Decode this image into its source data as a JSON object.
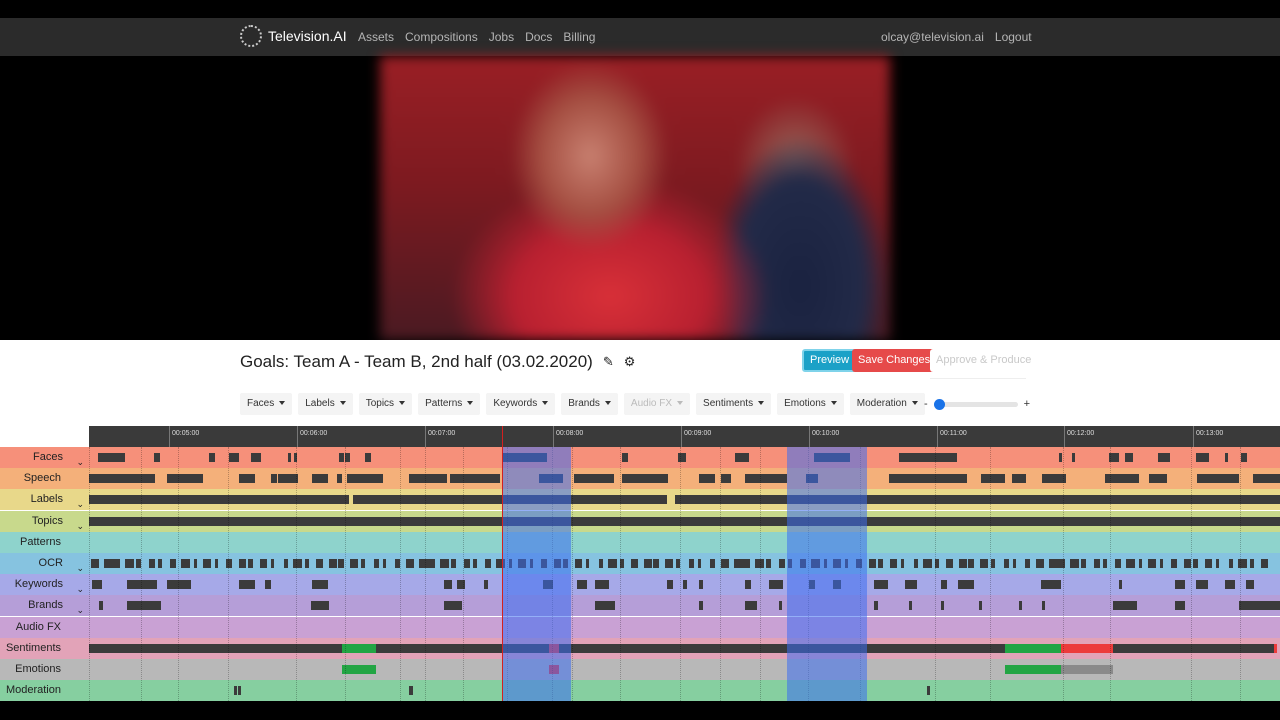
{
  "nav": {
    "brand": "Television.AI",
    "links": [
      "Assets",
      "Compositions",
      "Jobs",
      "Docs",
      "Billing"
    ],
    "user_email": "olcay@television.ai",
    "logout": "Logout"
  },
  "editor": {
    "title": "Goals: Team A - Team B, 2nd half (03.02.2020)",
    "edit_icon": "pencil-icon",
    "settings_icon": "gear-icon",
    "preview": "Preview",
    "save": "Save Changes",
    "approve": "Approve & Produce"
  },
  "filters": [
    {
      "label": "Faces",
      "disabled": false
    },
    {
      "label": "Labels",
      "disabled": false
    },
    {
      "label": "Topics",
      "disabled": false
    },
    {
      "label": "Patterns",
      "disabled": false
    },
    {
      "label": "Keywords",
      "disabled": false
    },
    {
      "label": "Brands",
      "disabled": false
    },
    {
      "label": "Audio FX",
      "disabled": true
    },
    {
      "label": "Sentiments",
      "disabled": false
    },
    {
      "label": "Emotions",
      "disabled": false
    },
    {
      "label": "Moderation",
      "disabled": false
    }
  ],
  "zoom": {
    "minus": "-",
    "plus": "+",
    "level": 0
  },
  "timeline": {
    "ticks": [
      "00:05:00",
      "00:06:00",
      "00:07:00",
      "00:08:00",
      "00:09:00",
      "00:10:00",
      "00:11:00",
      "00:12:00",
      "00:13:00"
    ],
    "rows": [
      {
        "label": "Faces",
        "chevron": true,
        "color": "#f6907a"
      },
      {
        "label": "Speech",
        "chevron": false,
        "color": "#f4b07a"
      },
      {
        "label": "Labels",
        "chevron": true,
        "color": "#e8d88a"
      },
      {
        "label": "Topics",
        "chevron": true,
        "color": "#c8d98c"
      },
      {
        "label": "Patterns",
        "chevron": false,
        "color": "#8ed3cc"
      },
      {
        "label": "OCR",
        "chevron": true,
        "color": "#86c3e0"
      },
      {
        "label": "Keywords",
        "chevron": true,
        "color": "#a6a9e8"
      },
      {
        "label": "Brands",
        "chevron": true,
        "color": "#b59ed8"
      },
      {
        "label": "Audio FX",
        "chevron": false,
        "color": "#c9a1d4"
      },
      {
        "label": "Sentiments",
        "chevron": false,
        "color": "#e2a3b8"
      },
      {
        "label": "Emotions",
        "chevron": false,
        "color": "#b8b8b8"
      },
      {
        "label": "Moderation",
        "chevron": false,
        "color": "#86cfa0"
      }
    ]
  }
}
